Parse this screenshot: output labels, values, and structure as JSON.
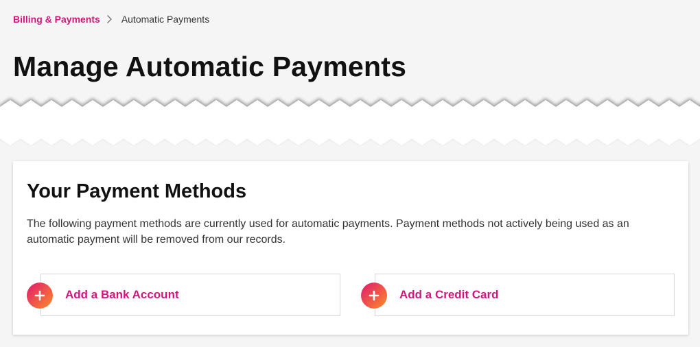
{
  "breadcrumb": {
    "parent": "Billing & Payments",
    "current": "Automatic Payments"
  },
  "page": {
    "title": "Manage Automatic Payments"
  },
  "payment_methods": {
    "title": "Your Payment Methods",
    "description": "The following payment methods are currently used for automatic payments. Payment methods not actively being used as an automatic payment will be removed from our records.",
    "add_bank_label": "Add a Bank Account",
    "add_card_label": "Add a Credit Card"
  },
  "icons": {
    "breadcrumb_separator": "chevron-right-icon",
    "add": "plus-icon"
  },
  "colors": {
    "accent": "#d4147c",
    "gradient_start": "#e0186f",
    "gradient_end": "#f78b2e",
    "background": "#f5f5f5"
  }
}
